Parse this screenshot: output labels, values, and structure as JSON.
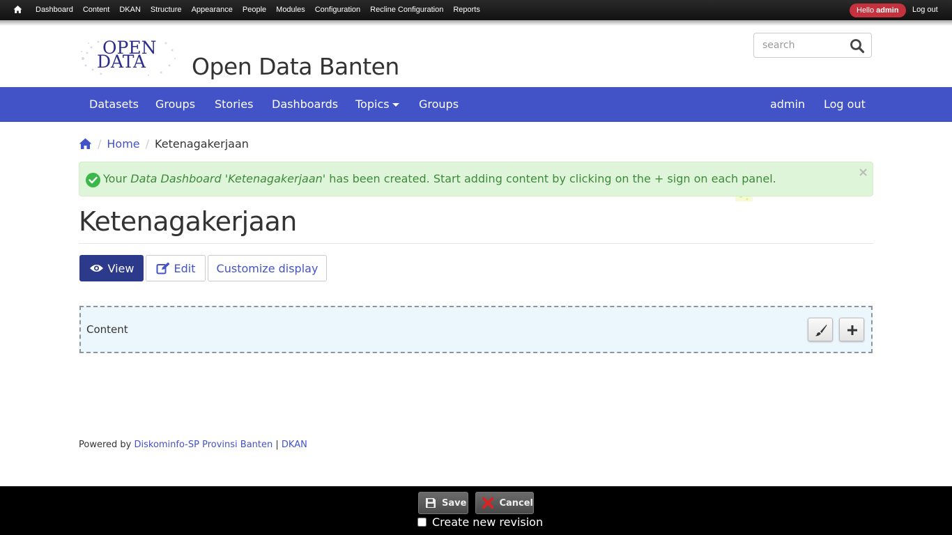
{
  "admin_toolbar": {
    "items": [
      "Dashboard",
      "Content",
      "DKAN",
      "Structure",
      "Appearance",
      "People",
      "Modules",
      "Configuration",
      "Recline Configuration",
      "Reports"
    ],
    "hello_prefix": "Hello",
    "hello_user": "admin",
    "logout": "Log out"
  },
  "site": {
    "logo_line1": "OPEN",
    "logo_line2": "DATA",
    "name": "Open Data Banten"
  },
  "search": {
    "placeholder": "search"
  },
  "main_nav": {
    "items": [
      "Datasets",
      "Groups",
      "Stories",
      "Dashboards",
      "Topics",
      "Groups"
    ],
    "user": "admin",
    "logout": "Log out"
  },
  "breadcrumb": {
    "home": "Home",
    "current": "Ketenagakerjaan"
  },
  "alert": {
    "part1": "Your ",
    "type": "Data Dashboard",
    "part2": " '",
    "name": "Ketenagakerjaan",
    "part3": "' has been created. Start adding content by clicking on the + sign on each panel.",
    "close": "×"
  },
  "page": {
    "title": "Ketenagakerjaan"
  },
  "tabs": {
    "view": "View",
    "edit": "Edit",
    "customize": "Customize display"
  },
  "region": {
    "label": "Content"
  },
  "footer": {
    "prefix": "Powered by ",
    "link1": "Diskominfo-SP Provinsi Banten",
    "separator": " | ",
    "link2": "DKAN"
  },
  "editor": {
    "save": "Save",
    "cancel": "Cancel",
    "revision": "Create new revision"
  },
  "colors": {
    "nav_blue": "#4253c7",
    "active_tab": "#2c3a8c",
    "alert_bg": "#dff5d9",
    "hello_badge": "#c4323e"
  }
}
